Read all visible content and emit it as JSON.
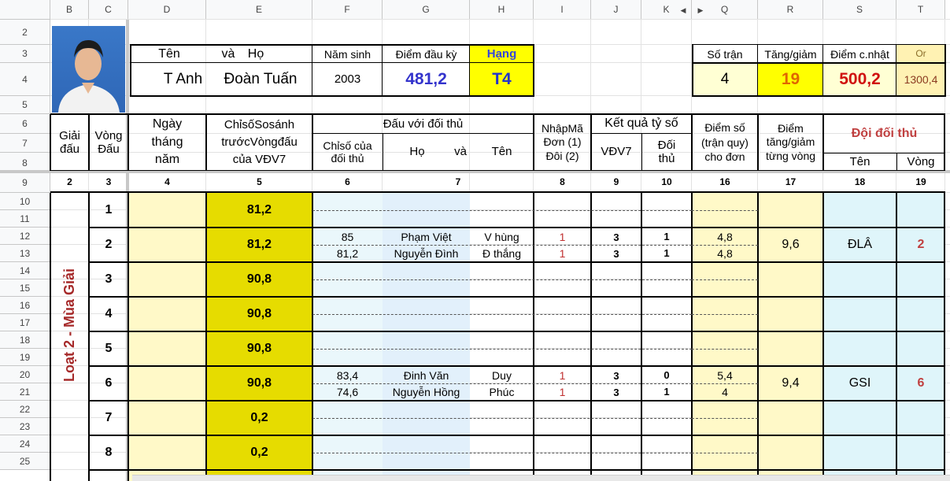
{
  "columns": [
    "B",
    "C",
    "D",
    "E",
    "F",
    "G",
    "H",
    "I",
    "J",
    "K",
    "Q",
    "R",
    "S",
    "T"
  ],
  "rows": [
    "2",
    "3",
    "4",
    "5",
    "6",
    "7",
    "8",
    "9",
    "10",
    "11",
    "12",
    "13",
    "14",
    "15",
    "16",
    "17",
    "18",
    "19",
    "20",
    "21",
    "22",
    "23",
    "24",
    "25"
  ],
  "player": {
    "h_name": "Tên",
    "h_and": "và",
    "h_surname": "Họ",
    "h_birth": "Năm sinh",
    "h_start_points": "Điểm đầu kỳ",
    "h_rank": "Hạng",
    "first_name": "T Anh",
    "last_name": "Đoàn Tuấn",
    "birth_year": "2003",
    "start_points": "481,2",
    "rank": "T4"
  },
  "summary": {
    "h_matches": "Số trận",
    "h_change": "Tăng/giảm",
    "h_updated": "Điểm c.nhật",
    "h_or": "Or",
    "matches": "4",
    "change": "19",
    "updated": "500,2",
    "or": "1300,4"
  },
  "table_header": {
    "tournament": "Giải\nđấu",
    "round": "Vòng\nĐấu",
    "date": "Ngày\ntháng\nnăm",
    "index_before": "ChỉsốSosánh\ntrướcVòngđấu\ncủa VĐV7",
    "opponents": "Đấu với đối thủ",
    "opp_index": "Chỉsố của\nđối thủ",
    "opp_ho": "Họ",
    "opp_va": "và",
    "opp_ten": "Tên",
    "input_code": "NhậpMã\nĐơn (1)\nĐôi (2)",
    "result": "Kết quả tỷ số",
    "vdv7": "VĐV7",
    "opponent_score": "Đối\nthủ",
    "points": "Điểm số\n(trận quy)\ncho đơn",
    "points_change": "Điểm\ntăng/giảm\ntừng vòng",
    "opp_team": "Đội đối thủ",
    "team_name": "Tên",
    "team_round": "Vòng"
  },
  "col_numbers": [
    "2",
    "3",
    "4",
    "5",
    "6",
    "7",
    "8",
    "9",
    "10",
    "16",
    "17",
    "18",
    "19"
  ],
  "season_label": "Loạt 2 - Mùa Giải",
  "rounds": [
    {
      "round": "1",
      "index": "81,2"
    },
    {
      "round": "2",
      "index": "81,2",
      "matches": [
        {
          "opp_index": "85",
          "name1": "Phạm Việt",
          "name2": "V hùng",
          "code": "1",
          "vdv7": "3",
          "opp": "1",
          "points": "4,8"
        },
        {
          "opp_index": "81,2",
          "name1": "Nguyễn Đình",
          "name2": "Đ thắng",
          "code": "1",
          "vdv7": "3",
          "opp": "1",
          "points": "4,8"
        }
      ],
      "change": "9,6",
      "team": "ĐLÂ",
      "team_round": "2"
    },
    {
      "round": "3",
      "index": "90,8"
    },
    {
      "round": "4",
      "index": "90,8"
    },
    {
      "round": "5",
      "index": "90,8"
    },
    {
      "round": "6",
      "index": "90,8",
      "matches": [
        {
          "opp_index": "83,4",
          "name1": "Đinh Văn",
          "name2": "Duy",
          "code": "1",
          "vdv7": "3",
          "opp": "0",
          "points": "5,4"
        },
        {
          "opp_index": "74,6",
          "name1": "Nguyễn Hồng",
          "name2": "Phúc",
          "code": "1",
          "vdv7": "3",
          "opp": "1",
          "points": "4"
        }
      ],
      "change": "9,4",
      "team": "GSI",
      "team_round": "6"
    },
    {
      "round": "7",
      "index": "0,2"
    },
    {
      "round": "8",
      "index": "0,2"
    }
  ]
}
